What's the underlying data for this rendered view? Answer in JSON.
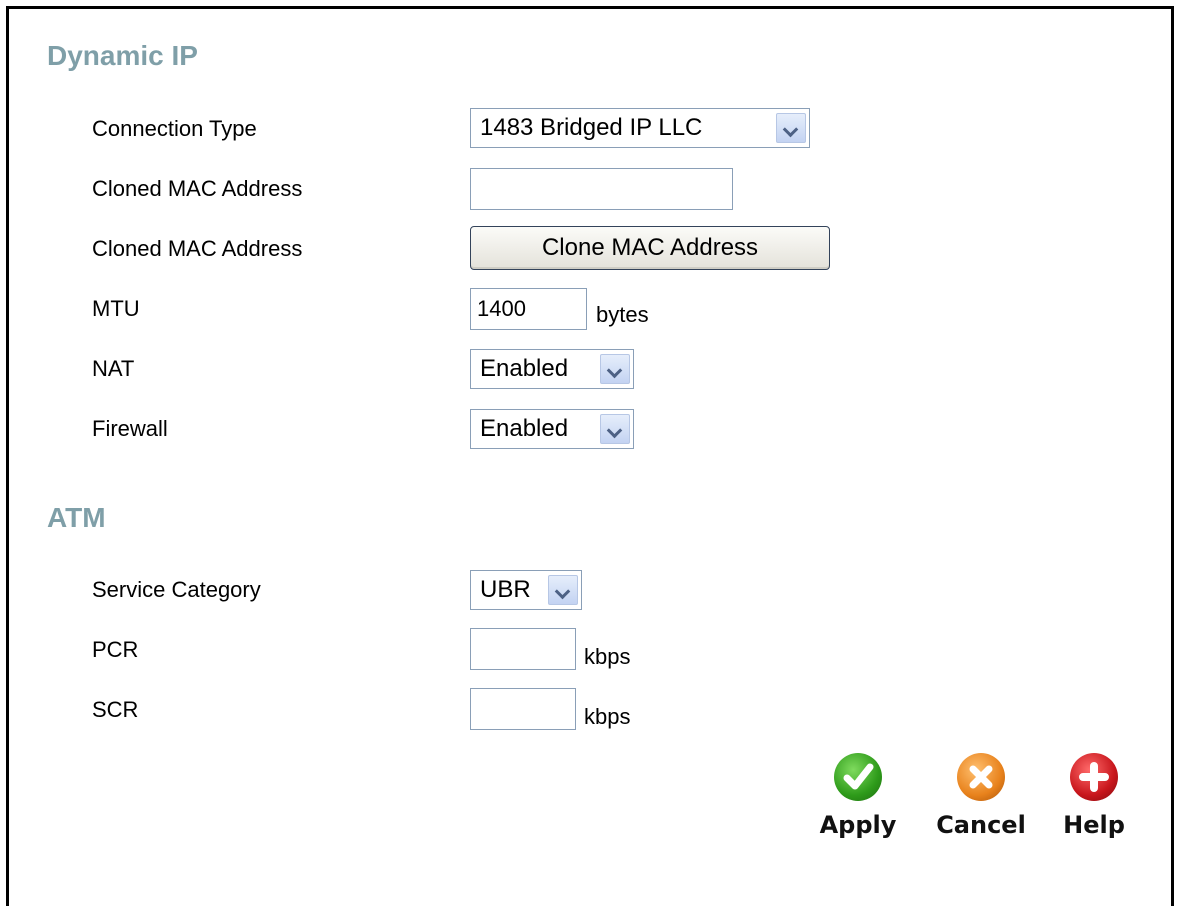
{
  "sections": {
    "dynamic_ip_title": "Dynamic IP",
    "atm_title": "ATM"
  },
  "fields": {
    "connection_type": {
      "label": "Connection Type",
      "value": "1483 Bridged IP LLC"
    },
    "cloned_mac_input": {
      "label": "Cloned MAC Address",
      "value": ""
    },
    "cloned_mac_button": {
      "label": "Cloned MAC Address",
      "button_label": "Clone MAC Address"
    },
    "mtu": {
      "label": "MTU",
      "value": "1400",
      "unit": "bytes"
    },
    "nat": {
      "label": "NAT",
      "value": "Enabled"
    },
    "firewall": {
      "label": "Firewall",
      "value": "Enabled"
    },
    "service_category": {
      "label": "Service Category",
      "value": "UBR"
    },
    "pcr": {
      "label": "PCR",
      "value": "",
      "unit": "kbps"
    },
    "scr": {
      "label": "SCR",
      "value": "",
      "unit": "kbps"
    }
  },
  "actions": {
    "apply": {
      "label": "Apply",
      "icon": "check-icon",
      "color": "#2e9b1a"
    },
    "cancel": {
      "label": "Cancel",
      "icon": "x-icon",
      "color": "#e8821c"
    },
    "help": {
      "label": "Help",
      "icon": "plus-icon",
      "color": "#c8161c"
    }
  }
}
